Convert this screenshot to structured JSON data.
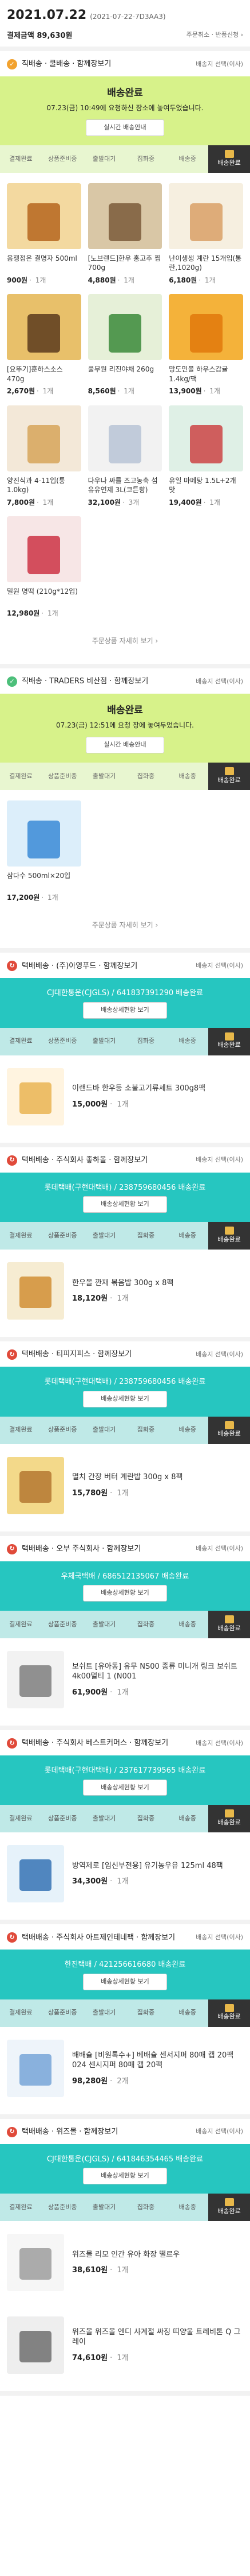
{
  "header": {
    "date": "2021.07.22",
    "date_sub": "(2021-07-22-7D3AA3)",
    "summary": "결제금액 89,630원",
    "links": "주문취소 · 반품신청 ›"
  },
  "steps": [
    "결제완료",
    "상품준비중",
    "출발대기",
    "집화중",
    "배송중",
    "배송완료"
  ],
  "shipments": [
    {
      "title": "직배송 · 쿨배송 · 함께장보기",
      "right": "배송지 선택(이사)",
      "badge_color": "#f2a22f",
      "status": "배송완료",
      "msg": "07.23(금) 10:49에 요청하신 장소에 놓여두었습니다.",
      "track": "실시간 배송안내",
      "theme": "green",
      "items": [
        {
          "name": "음쟁점은 결명자 500ml",
          "price": "900원",
          "qty": "1개",
          "c1": "#f3d9a0",
          "c2": "#b5651d"
        },
        {
          "name": "[노브랜드]한우 홍고추 찜 700g",
          "price": "4,880원",
          "qty": "1개",
          "c1": "#d9c7a6",
          "c2": "#7a5a3a"
        },
        {
          "name": "난이생생 계란 15개입(통란,1020g)",
          "price": "6,180원",
          "qty": "1개",
          "c1": "#f6efe0",
          "c2": "#d9a066"
        },
        {
          "name": "[요뚜기]훈하스소스 470g",
          "price": "2,670원",
          "qty": "1개",
          "c1": "#e8c06a",
          "c2": "#5a3a1c"
        },
        {
          "name": "풀무원 리진야채 260g",
          "price": "8,560원",
          "qty": "1개",
          "c1": "#e6f0d8",
          "c2": "#3a8a3a"
        },
        {
          "name": "망도민볼 하우스감귤 1.4kg/팩",
          "price": "13,900원",
          "qty": "1개",
          "c1": "#f4b23a",
          "c2": "#e0780c"
        },
        {
          "name": "양진식과 4-11입(통1.0kg)",
          "price": "7,800원",
          "qty": "1개",
          "c1": "#f3e8d8",
          "c2": "#d6a45a"
        },
        {
          "name": "다우나 싸를 즈고농축 섬유유연제 3L(코튼향)",
          "price": "32,100원",
          "qty": "3개",
          "c1": "#f2f2f2",
          "c2": "#b8c4d6"
        },
        {
          "name": "유일 마메탕 1.5L+2개 맛",
          "price": "19,400원",
          "qty": "1개",
          "c1": "#dff0e6",
          "c2": "#cc4444"
        },
        {
          "name": "밀원 명떡 (210g*12입)",
          "price": "12,980원",
          "qty": "1개",
          "c1": "#f7e6e6",
          "c2": "#cc3344"
        }
      ]
    },
    {
      "title": "직배송 · TRADERS 비산점 · 함께장보기",
      "right": "배송지 선택(이사)",
      "badge_color": "#4cbf7a",
      "status": "배송완료",
      "msg": "07.23(금) 12:51에 요청 장에 놓여두었습니다.",
      "track": "실시간 배송안내",
      "theme": "green",
      "items": [
        {
          "name": "삼다수 500ml×20입",
          "price": "17,200원",
          "qty": "1개",
          "c1": "#dceefa",
          "c2": "#3a8ad6"
        }
      ]
    },
    {
      "title": "택배배송 · (주)아영푸드 · 함께장보기",
      "right": "배송지 선택(이사)",
      "badge_color": "#e04a3a",
      "status": "CJ대한통운(CJGLS) / 641837391290 배송완료",
      "track": "배송상세현황 보기",
      "theme": "teal",
      "row": {
        "name": "이랜드바 한우등 소불고기류세트 300g8팩",
        "price": "15,000원",
        "qty": "1개",
        "c1": "#fff4e0",
        "c2": "#e8b04a"
      }
    },
    {
      "title": "택배배송 · 주식회사 좋하몰 · 함께장보기",
      "right": "배송지 선택(이사)",
      "badge_color": "#e04a3a",
      "status": "롯데택배(구현대택배) / 238759680456 배송완료",
      "track": "배송상세현황 보기",
      "theme": "teal",
      "row": {
        "name": "한우몰 깐재 볶음밥 300g x 8팩",
        "price": "18,120원",
        "qty": "1개",
        "c1": "#f6ecd2",
        "c2": "#d08a2a"
      }
    },
    {
      "title": "택배배송 · 티피지피스 · 함께장보기",
      "right": "배송지 선택(이사)",
      "badge_color": "#e04a3a",
      "status": "롯데택배(구현대택배) / 238759680456 배송완료",
      "track": "배송상세현황 보기",
      "theme": "teal",
      "row": {
        "name": "멸치 간장 버터 계란밥 300g x 8팩",
        "price": "15,780원",
        "qty": "1개",
        "c1": "#f3d98a",
        "c2": "#b0702a"
      }
    },
    {
      "title": "택배배송 · 오부 주식회사 · 함께장보기",
      "right": "배송지 선택(이사)",
      "badge_color": "#e04a3a",
      "status": "우체국택배 / 686512135067 배송완료",
      "track": "배송상세현황 보기",
      "theme": "teal",
      "row": {
        "name": "보쉬트 [유아동] 유무 NS00 종류 미니개 링크 보쉬트 4k00멀티 1 (N001",
        "price": "61,900원",
        "qty": "1개",
        "c1": "#f2f2f2",
        "c2": "#777"
      }
    },
    {
      "title": "택배배송 · 주식회사 베스트커머스 · 함께장보기",
      "right": "배송지 선택(이사)",
      "badge_color": "#e04a3a",
      "status": "롯데택배(구현대택배) / 237617739565 배송완료",
      "track": "배송상세현황 보기",
      "theme": "teal",
      "row": {
        "name": "방역제로 [임신부전용] 유기농우유 125ml 48팩",
        "price": "34,300원",
        "qty": "1개",
        "c1": "#e6f2fa",
        "c2": "#2a6ab0"
      }
    },
    {
      "title": "택배배송 · 주식회사 아트제인테네팩 · 함께장보기",
      "right": "배송지 선택(이사)",
      "badge_color": "#e04a3a",
      "status": "한진택배 / 421256616680 배송완료",
      "track": "배송상세현황 보기",
      "theme": "teal",
      "row": {
        "name": "배배슐 [비원톡수+] 베배슐 센서지퍼 80매 캡 20팩 024 센시지퍼 80매 캡 20팩",
        "price": "98,280원",
        "qty": "2개",
        "c1": "#eef4fa",
        "c2": "#6fa0d6"
      }
    },
    {
      "title": "택배배송 · 위즈몰 · 함께장보기",
      "right": "배송지 선택(이사)",
      "badge_color": "#e04a3a",
      "status": "CJ대한통운(CJGLS) / 641846354465 배송완료",
      "track": "배송상세현황 보기",
      "theme": "teal",
      "rows": [
        {
          "name": "위즈몰 리모 인간 유아 화장 떨르우",
          "price": "38,610원",
          "qty": "1개",
          "c1": "#f6f6f6",
          "c2": "#999"
        },
        {
          "name": "위즈몰 위즈몰 엔디 사계절 싸징 띠양울 트레비톤 Q 그레이",
          "price": "74,610원",
          "qty": "1개",
          "c1": "#eeeeee",
          "c2": "#666"
        }
      ]
    }
  ],
  "more_label": "주문상품 자세히 보기 ›"
}
